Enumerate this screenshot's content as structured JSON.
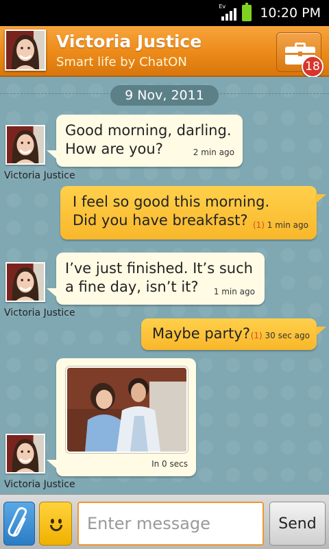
{
  "status_bar": {
    "network_label": "Ev",
    "time": "10:20 PM",
    "battery_color": "#7ed321"
  },
  "header": {
    "contact_name": "Victoria Justice",
    "subtitle": "Smart life by ChatON",
    "badge_count": "18",
    "accent_color": "#ec8a19",
    "icons": [
      "contact-avatar",
      "briefcase-icon"
    ]
  },
  "chat": {
    "date": "9 Nov, 2011",
    "messages": [
      {
        "direction": "incoming",
        "sender": "Victoria Justice",
        "line1": "Good morning, darling.",
        "line2": "How are you?",
        "time": "2 min ago"
      },
      {
        "direction": "outgoing",
        "line1": "I feel so good this morning.",
        "line2": "Did you have breakfast?",
        "count": "(1)",
        "time": "1 min ago"
      },
      {
        "direction": "incoming",
        "sender": "Victoria Justice",
        "line1": "I’ve just finished. It’s such",
        "line2": "a fine day, isn’t it?",
        "time": "1 min ago"
      },
      {
        "direction": "outgoing",
        "line1": "Maybe party?",
        "count": "(1)",
        "time": "30 sec ago"
      },
      {
        "direction": "incoming",
        "sender": "Victoria Justice",
        "type": "photo",
        "time": "In 0 secs"
      }
    ]
  },
  "composer": {
    "placeholder": "Enter message",
    "send_label": "Send",
    "icons": [
      "paperclip-icon",
      "emoji-icon"
    ]
  }
}
